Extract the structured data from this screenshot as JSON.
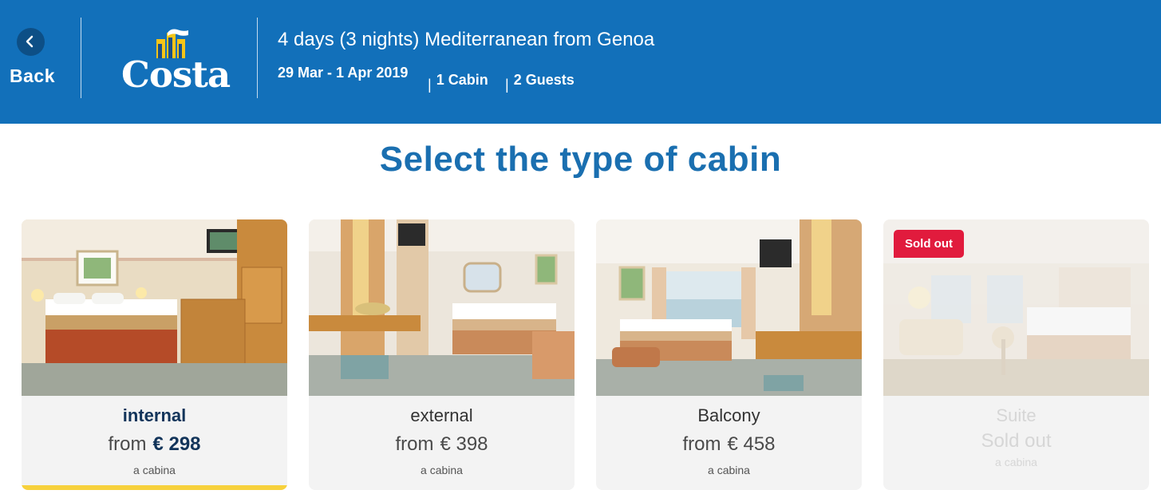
{
  "header": {
    "back_label": "Back",
    "logo_text": "Costa",
    "trip_title": "4 days (3 nights) Mediterranean from Genoa",
    "dates": "29 Mar - 1 Apr 2019",
    "cabins": "1 Cabin",
    "guests": "2 Guests",
    "separator": "|"
  },
  "page": {
    "title": "Select the type of cabin"
  },
  "cards": [
    {
      "name": "internal",
      "from_label": "from",
      "price": "€ 298",
      "unit": "a cabina",
      "selected": true,
      "sold_out": false
    },
    {
      "name": "external",
      "from_label": "from",
      "price": "€ 398",
      "unit": "a cabina",
      "selected": false,
      "sold_out": false
    },
    {
      "name": "Balcony",
      "from_label": "from",
      "price": "€ 458",
      "unit": "a cabina",
      "selected": false,
      "sold_out": false
    },
    {
      "name": "Suite",
      "status_text": "Sold out",
      "badge": "Sold out",
      "unit": "a cabina",
      "selected": false,
      "sold_out": true
    }
  ],
  "colors": {
    "header_bg": "#1270ba",
    "title_blue": "#1a6fb0",
    "selected_bar": "#f7d13c",
    "sold_badge": "#e11b3d"
  }
}
